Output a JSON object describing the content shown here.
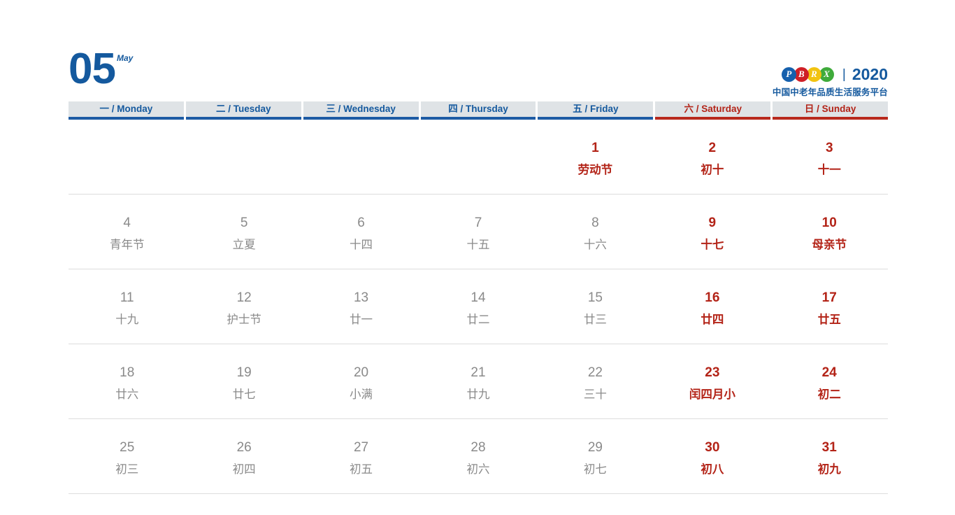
{
  "header": {
    "month_number": "05",
    "month_en": "May",
    "brand": {
      "logo_letters": [
        "P",
        "B",
        "R",
        "X"
      ],
      "logo_colors": [
        "#1560ad",
        "#cf2027",
        "#f2c310",
        "#3fab3b"
      ],
      "separator": "|",
      "year": "2020",
      "subtitle": "中国中老年品质生活服务平台"
    },
    "accent_blue": "#14599e",
    "accent_red": "#b32317"
  },
  "weekdays": [
    {
      "label": "一 / Monday",
      "weekend": false
    },
    {
      "label": "二 / Tuesday",
      "weekend": false
    },
    {
      "label": "三 / Wednesday",
      "weekend": false
    },
    {
      "label": "四 / Thursday",
      "weekend": false
    },
    {
      "label": "五 / Friday",
      "weekend": false
    },
    {
      "label": "六 / Saturday",
      "weekend": true
    },
    {
      "label": "日 / Sunday",
      "weekend": true
    }
  ],
  "weeks": [
    [
      {
        "num": "",
        "sub": "",
        "red": false,
        "empty": true
      },
      {
        "num": "",
        "sub": "",
        "red": false,
        "empty": true
      },
      {
        "num": "",
        "sub": "",
        "red": false,
        "empty": true
      },
      {
        "num": "",
        "sub": "",
        "red": false,
        "empty": true
      },
      {
        "num": "1",
        "sub": "劳动节",
        "red": true,
        "empty": false
      },
      {
        "num": "2",
        "sub": "初十",
        "red": true,
        "empty": false
      },
      {
        "num": "3",
        "sub": "十一",
        "red": true,
        "empty": false
      }
    ],
    [
      {
        "num": "4",
        "sub": "青年节",
        "red": false,
        "empty": false
      },
      {
        "num": "5",
        "sub": "立夏",
        "red": false,
        "empty": false
      },
      {
        "num": "6",
        "sub": "十四",
        "red": false,
        "empty": false
      },
      {
        "num": "7",
        "sub": "十五",
        "red": false,
        "empty": false
      },
      {
        "num": "8",
        "sub": "十六",
        "red": false,
        "empty": false
      },
      {
        "num": "9",
        "sub": "十七",
        "red": true,
        "empty": false
      },
      {
        "num": "10",
        "sub": "母亲节",
        "red": true,
        "empty": false
      }
    ],
    [
      {
        "num": "11",
        "sub": "十九",
        "red": false,
        "empty": false
      },
      {
        "num": "12",
        "sub": "护士节",
        "red": false,
        "empty": false
      },
      {
        "num": "13",
        "sub": "廿一",
        "red": false,
        "empty": false
      },
      {
        "num": "14",
        "sub": "廿二",
        "red": false,
        "empty": false
      },
      {
        "num": "15",
        "sub": "廿三",
        "red": false,
        "empty": false
      },
      {
        "num": "16",
        "sub": "廿四",
        "red": true,
        "empty": false
      },
      {
        "num": "17",
        "sub": "廿五",
        "red": true,
        "empty": false
      }
    ],
    [
      {
        "num": "18",
        "sub": "廿六",
        "red": false,
        "empty": false
      },
      {
        "num": "19",
        "sub": "廿七",
        "red": false,
        "empty": false
      },
      {
        "num": "20",
        "sub": "小满",
        "red": false,
        "empty": false
      },
      {
        "num": "21",
        "sub": "廿九",
        "red": false,
        "empty": false
      },
      {
        "num": "22",
        "sub": "三十",
        "red": false,
        "empty": false
      },
      {
        "num": "23",
        "sub": "闰四月小",
        "red": true,
        "empty": false
      },
      {
        "num": "24",
        "sub": "初二",
        "red": true,
        "empty": false
      }
    ],
    [
      {
        "num": "25",
        "sub": "初三",
        "red": false,
        "empty": false
      },
      {
        "num": "26",
        "sub": "初四",
        "red": false,
        "empty": false
      },
      {
        "num": "27",
        "sub": "初五",
        "red": false,
        "empty": false
      },
      {
        "num": "28",
        "sub": "初六",
        "red": false,
        "empty": false
      },
      {
        "num": "29",
        "sub": "初七",
        "red": false,
        "empty": false
      },
      {
        "num": "30",
        "sub": "初八",
        "red": true,
        "empty": false
      },
      {
        "num": "31",
        "sub": "初九",
        "red": true,
        "empty": false
      }
    ]
  ]
}
